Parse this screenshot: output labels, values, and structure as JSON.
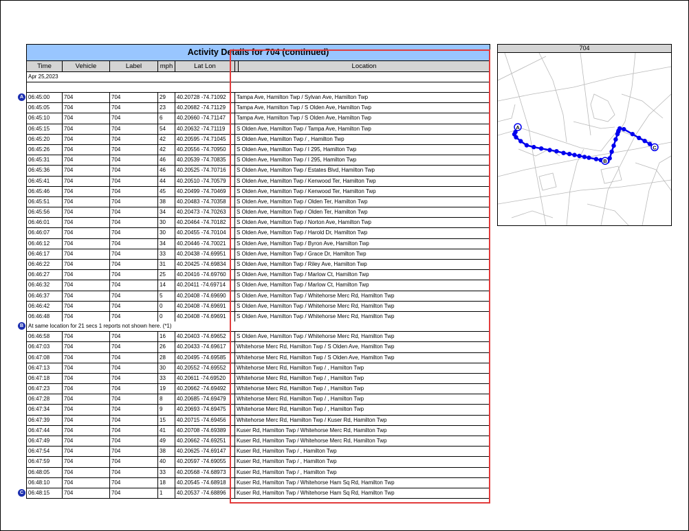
{
  "report": {
    "title": "Activity Details for 704 (continued)",
    "columns": [
      "Time",
      "Vehicle",
      "Label",
      "mph",
      "Lat Lon",
      "Location"
    ],
    "date": "Apr 25,2023",
    "note": "At same location for 21 secs  1 reports not shown here. (*1)",
    "markers": {
      "a": "A",
      "b": "B",
      "c": "C"
    },
    "rows_before_note": [
      {
        "time": "06:45:00",
        "vehicle": "704",
        "label": "704",
        "mph": "29",
        "latlon": "40.20728 -74.71092",
        "location": "Tampa Ave, Hamilton Twp /  Sylvan Ave, Hamilton Twp"
      },
      {
        "time": "06:45:05",
        "vehicle": "704",
        "label": "704",
        "mph": "23",
        "latlon": "40.20682 -74.71129",
        "location": "Tampa Ave, Hamilton Twp / S Olden Ave, Hamilton Twp"
      },
      {
        "time": "06:45:10",
        "vehicle": "704",
        "label": "704",
        "mph": "6",
        "latlon": "40.20660 -74.71147",
        "location": "Tampa Ave, Hamilton Twp / S Olden Ave, Hamilton Twp"
      },
      {
        "time": "06:45:15",
        "vehicle": "704",
        "label": "704",
        "mph": "54",
        "latlon": "40.20632 -74.71119",
        "location": "S Olden Ave, Hamilton Twp /  Tampa Ave, Hamilton Twp"
      },
      {
        "time": "06:45:20",
        "vehicle": "704",
        "label": "704",
        "mph": "42",
        "latlon": "40.20595 -74.71045",
        "location": "S Olden Ave, Hamilton Twp /  , Hamilton Twp"
      },
      {
        "time": "06:45:26",
        "vehicle": "704",
        "label": "704",
        "mph": "42",
        "latlon": "40.20556 -74.70950",
        "location": "S Olden Ave, Hamilton Twp /  I 295, Hamilton Twp"
      },
      {
        "time": "06:45:31",
        "vehicle": "704",
        "label": "704",
        "mph": "46",
        "latlon": "40.20539 -74.70835",
        "location": "S Olden Ave, Hamilton Twp /  I 295, Hamilton Twp"
      },
      {
        "time": "06:45:36",
        "vehicle": "704",
        "label": "704",
        "mph": "46",
        "latlon": "40.20525 -74.70716",
        "location": "S Olden Ave, Hamilton Twp /  Estates Blvd, Hamilton Twp"
      },
      {
        "time": "06:45:41",
        "vehicle": "704",
        "label": "704",
        "mph": "44",
        "latlon": "40.20510 -74.70579",
        "location": "S Olden Ave, Hamilton Twp /  Kenwood Ter, Hamilton Twp"
      },
      {
        "time": "06:45:46",
        "vehicle": "704",
        "label": "704",
        "mph": "45",
        "latlon": "40.20499 -74.70469",
        "location": "S Olden Ave, Hamilton Twp /  Kenwood Ter, Hamilton Twp"
      },
      {
        "time": "06:45:51",
        "vehicle": "704",
        "label": "704",
        "mph": "38",
        "latlon": "40.20483 -74.70358",
        "location": "S Olden Ave, Hamilton Twp /  Olden Ter, Hamilton Twp"
      },
      {
        "time": "06:45:56",
        "vehicle": "704",
        "label": "704",
        "mph": "34",
        "latlon": "40.20473 -74.70263",
        "location": "S Olden Ave, Hamilton Twp /  Olden Ter, Hamilton Twp"
      },
      {
        "time": "06:46:01",
        "vehicle": "704",
        "label": "704",
        "mph": "30",
        "latlon": "40.20464 -74.70182",
        "location": "S Olden Ave, Hamilton Twp /  Norton Ave, Hamilton Twp"
      },
      {
        "time": "06:46:07",
        "vehicle": "704",
        "label": "704",
        "mph": "30",
        "latlon": "40.20455 -74.70104",
        "location": "S Olden Ave, Hamilton Twp /  Harold Dr, Hamilton Twp"
      },
      {
        "time": "06:46:12",
        "vehicle": "704",
        "label": "704",
        "mph": "34",
        "latlon": "40.20446 -74.70021",
        "location": "S Olden Ave, Hamilton Twp /  Byron Ave, Hamilton Twp"
      },
      {
        "time": "06:46:17",
        "vehicle": "704",
        "label": "704",
        "mph": "33",
        "latlon": "40.20438 -74.69951",
        "location": "S Olden Ave, Hamilton Twp /  Grace Dr, Hamilton Twp"
      },
      {
        "time": "06:46:22",
        "vehicle": "704",
        "label": "704",
        "mph": "31",
        "latlon": "40.20425 -74.69834",
        "location": "S Olden Ave, Hamilton Twp /  Riley Ave, Hamilton Twp"
      },
      {
        "time": "06:46:27",
        "vehicle": "704",
        "label": "704",
        "mph": "25",
        "latlon": "40.20416 -74.69760",
        "location": "S Olden Ave, Hamilton Twp /  Marlow Ct, Hamilton Twp"
      },
      {
        "time": "06:46:32",
        "vehicle": "704",
        "label": "704",
        "mph": "14",
        "latlon": "40.20411 -74.69714",
        "location": "S Olden Ave, Hamilton Twp /  Marlow Ct, Hamilton Twp"
      },
      {
        "time": "06:46:37",
        "vehicle": "704",
        "label": "704",
        "mph": "5",
        "latlon": "40.20408 -74.69690",
        "location": "S Olden Ave, Hamilton Twp /  Whitehorse Merc Rd, Hamilton Twp"
      },
      {
        "time": "06:46:42",
        "vehicle": "704",
        "label": "704",
        "mph": "0",
        "latlon": "40.20408 -74.69691",
        "location": "S Olden Ave, Hamilton Twp /  Whitehorse Merc Rd, Hamilton Twp"
      },
      {
        "time": "06:46:48",
        "vehicle": "704",
        "label": "704",
        "mph": "0",
        "latlon": "40.20408 -74.69691",
        "location": "S Olden Ave, Hamilton Twp /  Whitehorse Merc Rd, Hamilton Twp"
      }
    ],
    "rows_after_note": [
      {
        "time": "06:46:58",
        "vehicle": "704",
        "label": "704",
        "mph": "16",
        "latlon": "40.20403 -74.69652",
        "location": "S Olden Ave, Hamilton Twp /  Whitehorse Merc Rd, Hamilton Twp"
      },
      {
        "time": "06:47:03",
        "vehicle": "704",
        "label": "704",
        "mph": "26",
        "latlon": "40.20433 -74.69617",
        "location": "Whitehorse Merc Rd, Hamilton Twp / S Olden Ave, Hamilton Twp"
      },
      {
        "time": "06:47:08",
        "vehicle": "704",
        "label": "704",
        "mph": "28",
        "latlon": "40.20495 -74.69585",
        "location": "Whitehorse Merc Rd, Hamilton Twp / S Olden Ave, Hamilton Twp"
      },
      {
        "time": "06:47:13",
        "vehicle": "704",
        "label": "704",
        "mph": "30",
        "latlon": "40.20552 -74.69552",
        "location": "Whitehorse Merc Rd, Hamilton Twp /  , Hamilton Twp"
      },
      {
        "time": "06:47:18",
        "vehicle": "704",
        "label": "704",
        "mph": "33",
        "latlon": "40.20611 -74.69520",
        "location": "Whitehorse Merc Rd, Hamilton Twp /  , Hamilton Twp"
      },
      {
        "time": "06:47:23",
        "vehicle": "704",
        "label": "704",
        "mph": "19",
        "latlon": "40.20662 -74.69492",
        "location": "Whitehorse Merc Rd, Hamilton Twp /  , Hamilton Twp"
      },
      {
        "time": "06:47:28",
        "vehicle": "704",
        "label": "704",
        "mph": "8",
        "latlon": "40.20685 -74.69479",
        "location": "Whitehorse Merc Rd, Hamilton Twp /  , Hamilton Twp"
      },
      {
        "time": "06:47:34",
        "vehicle": "704",
        "label": "704",
        "mph": "9",
        "latlon": "40.20693 -74.69475",
        "location": "Whitehorse Merc Rd, Hamilton Twp /  , Hamilton Twp"
      },
      {
        "time": "06:47:39",
        "vehicle": "704",
        "label": "704",
        "mph": "15",
        "latlon": "40.20715 -74.69456",
        "location": "Whitehorse Merc Rd, Hamilton Twp /  Kuser Rd, Hamilton Twp"
      },
      {
        "time": "06:47:44",
        "vehicle": "704",
        "label": "704",
        "mph": "41",
        "latlon": "40.20708 -74.69389",
        "location": "Kuser Rd, Hamilton Twp /  Whitehorse Merc Rd, Hamilton Twp"
      },
      {
        "time": "06:47:49",
        "vehicle": "704",
        "label": "704",
        "mph": "49",
        "latlon": "40.20662 -74.69251",
        "location": "Kuser Rd, Hamilton Twp /  Whitehorse Merc Rd, Hamilton Twp"
      },
      {
        "time": "06:47:54",
        "vehicle": "704",
        "label": "704",
        "mph": "38",
        "latlon": "40.20625 -74.69147",
        "location": "Kuser Rd, Hamilton Twp /  , Hamilton Twp"
      },
      {
        "time": "06:47:59",
        "vehicle": "704",
        "label": "704",
        "mph": "40",
        "latlon": "40.20597 -74.69055",
        "location": "Kuser Rd, Hamilton Twp /  , Hamilton Twp"
      },
      {
        "time": "06:48:05",
        "vehicle": "704",
        "label": "704",
        "mph": "33",
        "latlon": "40.20568 -74.68973",
        "location": "Kuser Rd, Hamilton Twp /  , Hamilton Twp"
      },
      {
        "time": "06:48:10",
        "vehicle": "704",
        "label": "704",
        "mph": "18",
        "latlon": "40.20545 -74.68918",
        "location": "Kuser Rd, Hamilton Twp /  Whitehorse Ham Sq Rd, Hamilton Twp"
      },
      {
        "time": "06:48:15",
        "vehicle": "704",
        "label": "704",
        "mph": "1",
        "latlon": "40.20537 -74.68896",
        "location": "Kuser Rd, Hamilton Twp /  Whitehorse Ham Sq Rd, Hamilton Twp"
      }
    ]
  },
  "map": {
    "title": "704",
    "route_color": "#0000ee",
    "marker_labels": [
      "A",
      "B",
      "C"
    ]
  },
  "colors": {
    "title_bg": "#99c6ff",
    "header_bg": "#d4d4d4",
    "marker_bg": "#1c2fb0",
    "highlight": "#e23b3b"
  }
}
